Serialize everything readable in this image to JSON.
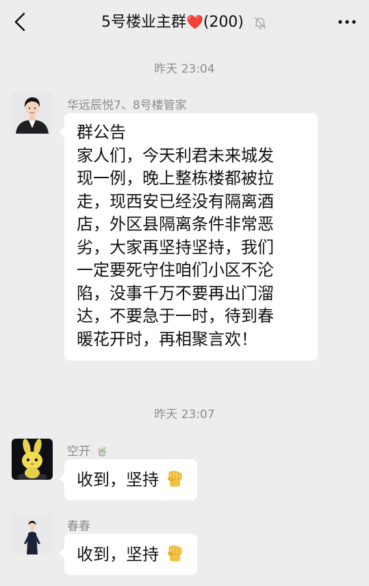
{
  "header": {
    "back_icon": "back-chevron-icon",
    "title": "5号楼业主群",
    "heart": "❤️",
    "member_count": "(200)",
    "mute_icon": "bell-muted-icon",
    "more_icon": "more-dots-icon"
  },
  "messages": [
    {
      "timestamp": "昨天 23:04",
      "sender": "华远辰悦7、8号楼管家",
      "avatar_icon": "avatar-woman-suit",
      "lines": [
        "群公告",
        "家人们，今天利君未来城发",
        "现一例，晚上整栋楼都被拉",
        "走，现西安已经没有隔离酒",
        "店，外区县隔离条件非常恶",
        "劣，大家再坚持坚持，我们",
        "一定要死守住咱们小区不沦",
        "陷，没事千万不要再出门溜",
        "达，不要急于一时，待到春",
        "暖花开时，再相聚言欢！"
      ]
    },
    {
      "timestamp": "昨天 23:07",
      "sender": "空开",
      "sender_badge_icon": "plant-pot-icon",
      "avatar_icon": "avatar-yellow-rabbit",
      "text": "收到，坚持",
      "emoji_icon": "raised-fist-icon"
    },
    {
      "sender": "春春",
      "avatar_icon": "avatar-woman-standing",
      "text": "收到，坚持",
      "emoji_icon": "raised-fist-icon"
    }
  ],
  "colors": {
    "background": "#ededed",
    "bubble": "#ffffff",
    "meta_text": "#8c8c8c",
    "heart": "#e02020",
    "fist": "#f5c242"
  }
}
